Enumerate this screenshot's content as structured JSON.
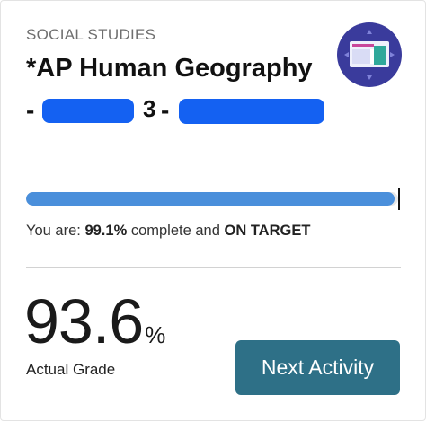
{
  "card": {
    "subject": "SOCIAL STUDIES",
    "course_title": "*AP Human Geography",
    "course_sub": {
      "dash1": "-",
      "dash2": "-"
    },
    "badge_icon": "course-badge-icon",
    "progress": {
      "fraction": 0.991,
      "prefix": "You are: ",
      "percent": "99.1%",
      "middle": " complete and ",
      "status": "ON TARGET"
    },
    "grade": {
      "value": "93.6",
      "unit": "%",
      "label": "Actual Grade"
    },
    "next_button_label": "Next Activity"
  },
  "colors": {
    "progress_fill": "#4a8fdb",
    "button_bg": "#2e7087",
    "badge_bg": "#3a3b9c",
    "redaction": "#1461f2"
  }
}
